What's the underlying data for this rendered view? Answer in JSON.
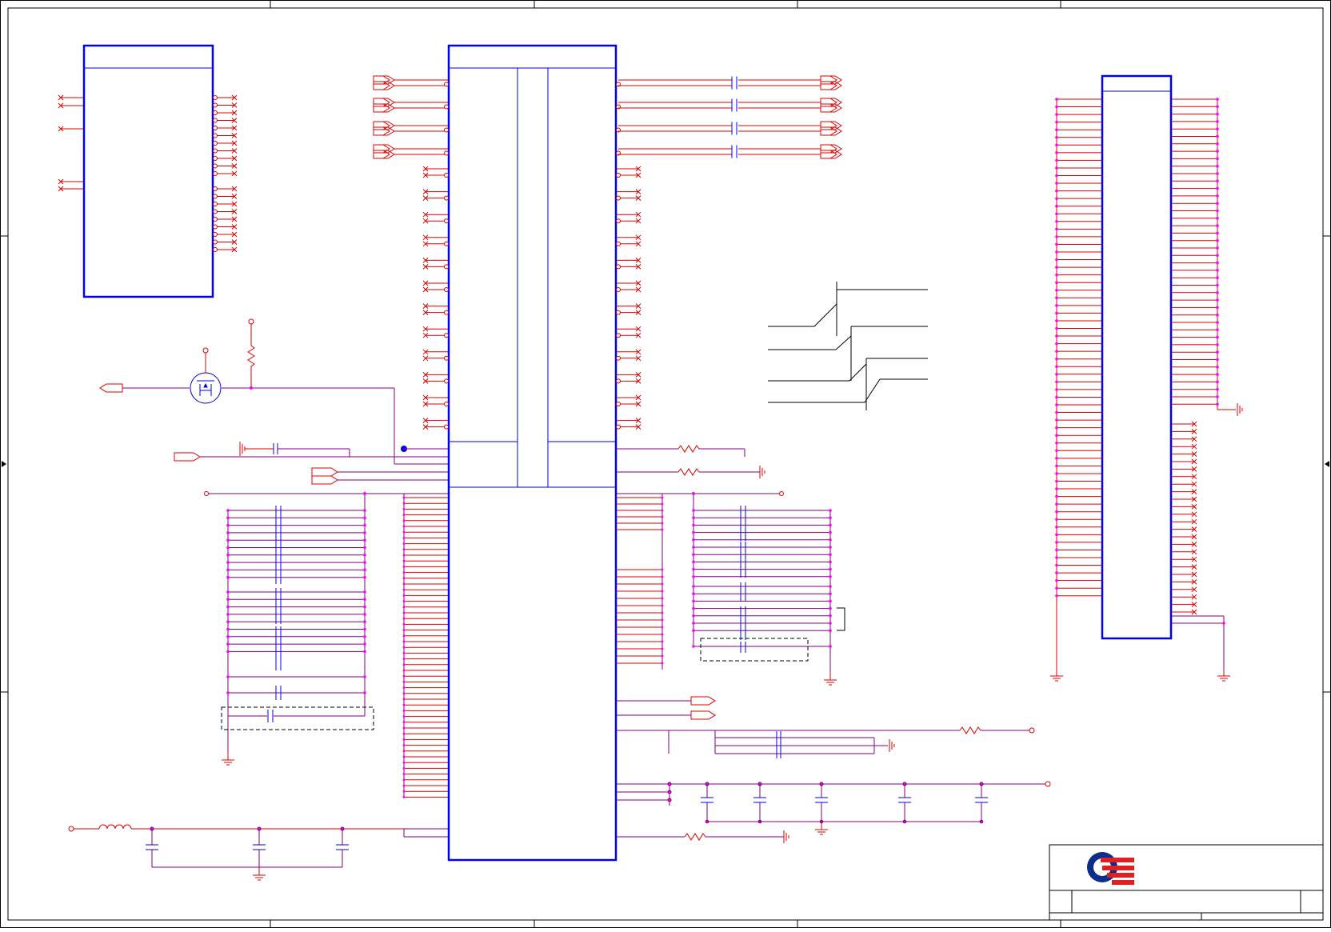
{
  "sheet": {
    "colors": {
      "frame": "#000000",
      "component_box": "#0000ee",
      "wire_red": "#dd0000",
      "wire_purple": "#800080",
      "pin_dot": "#ff00ff",
      "junction": "#0000ee",
      "logo_blue": "#0a2e8c",
      "logo_red": "#e02020"
    },
    "icons": [
      "resistor-icon",
      "capacitor-icon",
      "inductor-icon",
      "ground-icon",
      "mosfet-icon",
      "port-connector-icon",
      "no-connect-icon",
      "company-logo-icon"
    ]
  }
}
